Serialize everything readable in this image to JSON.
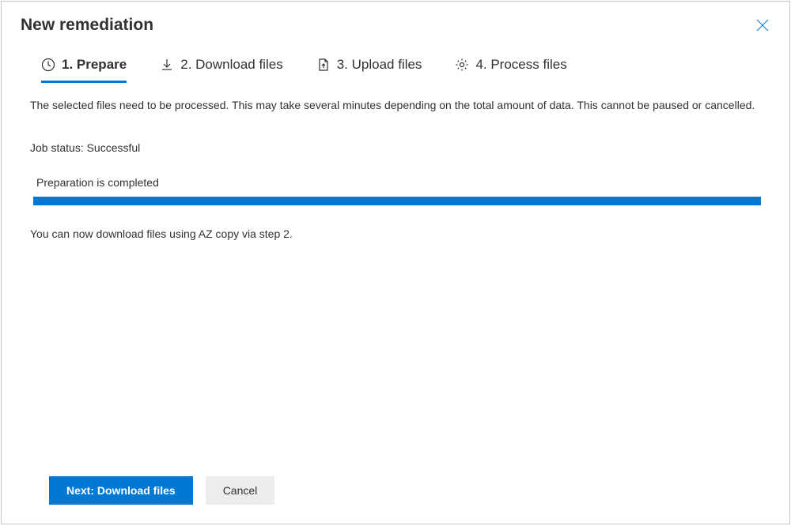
{
  "dialog": {
    "title": "New remediation"
  },
  "tabs": [
    {
      "label": "1. Prepare",
      "icon": "clock-icon",
      "active": true
    },
    {
      "label": "2. Download files",
      "icon": "download-icon",
      "active": false
    },
    {
      "label": "3. Upload files",
      "icon": "file-upload-icon",
      "active": false
    },
    {
      "label": "4. Process files",
      "icon": "gear-icon",
      "active": false
    }
  ],
  "content": {
    "description": "The selected files need to be processed. This may take several minutes depending on the total amount of data. This cannot be paused or cancelled.",
    "job_status_label": "Job status:",
    "job_status_value": "Successful",
    "progress_label": "Preparation is completed",
    "progress_percent": 100,
    "next_hint": "You can now download files using AZ copy via step 2."
  },
  "footer": {
    "primary_label": "Next: Download files",
    "secondary_label": "Cancel"
  },
  "colors": {
    "accent": "#0078d4"
  }
}
